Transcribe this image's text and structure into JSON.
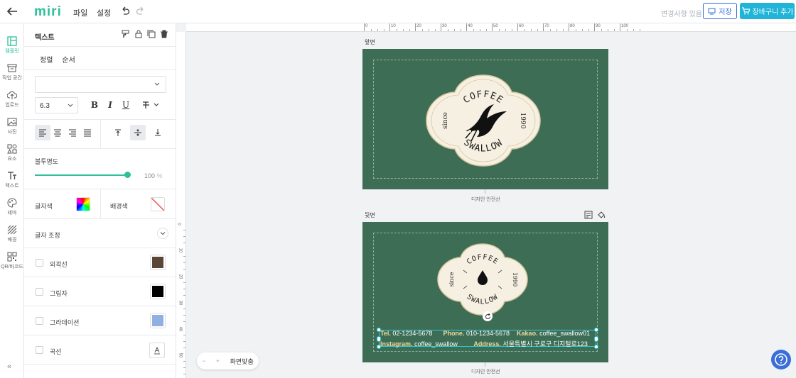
{
  "topbar": {
    "logo": "miri",
    "menus": [
      "파일",
      "설정"
    ],
    "save_hint": "변경사항 있음",
    "save_label": "저장",
    "cart_label": "장바구니 추가"
  },
  "nav": {
    "items": [
      {
        "label": "템플릿",
        "icon": "template-icon"
      },
      {
        "label": "작업 공간",
        "icon": "archive-icon"
      },
      {
        "label": "업로드",
        "icon": "upload-icon"
      },
      {
        "label": "사진",
        "icon": "photo-icon"
      },
      {
        "label": "요소",
        "icon": "shapes-icon"
      },
      {
        "label": "텍스트",
        "icon": "text-icon"
      },
      {
        "label": "테마",
        "icon": "palette-icon"
      },
      {
        "label": "배경",
        "icon": "background-icon"
      },
      {
        "label": "QR/바코드",
        "icon": "qr-icon"
      }
    ],
    "collapse": "«"
  },
  "panel": {
    "title": "텍스트",
    "tabs": [
      "정렬",
      "순서"
    ],
    "font_size": "6.3",
    "opacity_label": "불투명도",
    "opacity_value": "100",
    "opacity_unit": "%",
    "text_color_label": "글자색",
    "bg_color_label": "배경색",
    "spacing_label": "글자 조정",
    "outline_label": "외곽선",
    "shadow_label": "그림자",
    "gradient_label": "그라데이션",
    "curve_label": "곡선",
    "colors": {
      "outline": "#5a4636",
      "shadow": "#000000",
      "gradient": "#8fb0e0"
    }
  },
  "canvas": {
    "ruler_h": [
      "0",
      "10",
      "20",
      "30",
      "40",
      "50",
      "60",
      "70",
      "80",
      "90",
      "100"
    ],
    "ruler_v": [
      "0",
      "10",
      "20",
      "30",
      "40",
      "50"
    ],
    "front_label": "앞면",
    "back_label": "뒷면",
    "safe_label": "디자인 안전선",
    "card_color": "#3d6e55",
    "logo": {
      "top": "COFFEE",
      "bottom": "SWALLOW",
      "left": "since",
      "right": "1990"
    },
    "back_text": {
      "tel_label": "Tel.",
      "tel": "02-1234-5678",
      "phone_label": "Phone.",
      "phone": "010-1234-5678",
      "kakao_label": "Kakao.",
      "kakao": "coffee_swallow01",
      "insta_label": "Instagram.",
      "insta": "coffee_swallow",
      "addr_label": "Address.",
      "addr": "서울특별시 구로구 디지털로123"
    },
    "zoom_minus": "−",
    "zoom_plus": "+",
    "zoom_label": "화면맞춤"
  }
}
